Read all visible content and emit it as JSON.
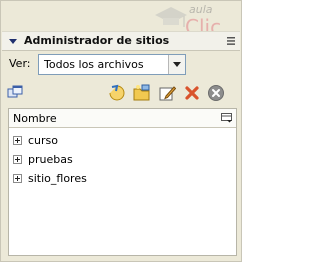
{
  "panel": {
    "title": "Administrador de sitios",
    "watermark": {
      "top": "aula",
      "bottom": "Clic"
    }
  },
  "filter": {
    "label": "Ver:",
    "selected": "Todos los archivos"
  },
  "toolbar": {
    "icons": [
      "view-mode-icon",
      "connect-icon",
      "new-site-icon",
      "edit-icon",
      "delete-icon",
      "cancel-icon"
    ]
  },
  "tree": {
    "header": "Nombre",
    "items": [
      {
        "label": "curso"
      },
      {
        "label": "pruebas"
      },
      {
        "label": "sitio_flores"
      }
    ]
  },
  "colors": {
    "panel_bg": "#ece9d8",
    "title_arrow": "#1f2f6e",
    "delete": "#d9532c"
  }
}
